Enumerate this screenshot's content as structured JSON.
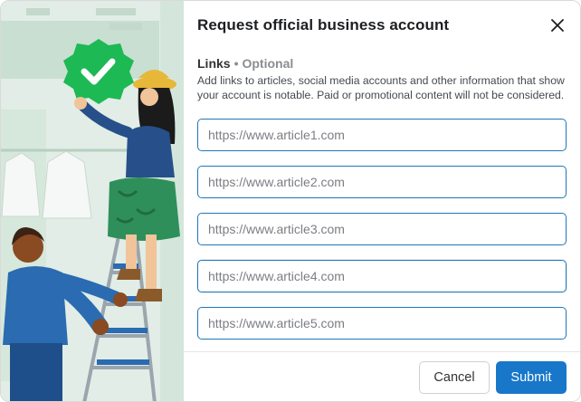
{
  "dialog": {
    "title": "Request official business account",
    "close_icon": "close-icon"
  },
  "links_section": {
    "label": "Links",
    "separator": "•",
    "optional_label": "Optional",
    "description": "Add links to articles, social media accounts and other information that show your account is notable. Paid or promotional content will not be considered."
  },
  "link_inputs": [
    {
      "placeholder": "https://www.article1.com",
      "value": ""
    },
    {
      "placeholder": "https://www.article2.com",
      "value": ""
    },
    {
      "placeholder": "https://www.article3.com",
      "value": ""
    },
    {
      "placeholder": "https://www.article4.com",
      "value": ""
    },
    {
      "placeholder": "https://www.article5.com",
      "value": ""
    }
  ],
  "footer": {
    "cancel_label": "Cancel",
    "submit_label": "Submit"
  },
  "colors": {
    "primary": "#1877c9",
    "input_border": "#1f78b8",
    "badge_green": "#1db954",
    "illustration_bg": "#e1ede6"
  }
}
